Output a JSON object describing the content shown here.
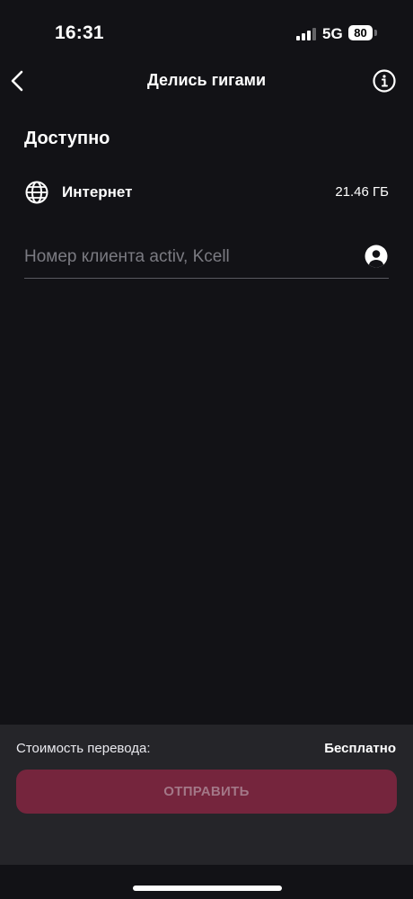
{
  "status_bar": {
    "time": "16:31",
    "network": "5G",
    "battery": "80",
    "icons": [
      "signal-icon",
      "battery-icon"
    ]
  },
  "nav": {
    "title": "Делись гигами",
    "back_icon": "chevron-left-icon",
    "info_icon": "info-icon"
  },
  "available": {
    "title": "Доступно",
    "items": [
      {
        "icon": "globe-icon",
        "label": "Интернет",
        "value": "21.46 ГБ"
      }
    ]
  },
  "recipient": {
    "placeholder": "Номер клиента activ, Kcell",
    "value": "",
    "contact_icon": "contact-icon"
  },
  "footer": {
    "cost_label": "Стоимость перевода:",
    "cost_value": "Бесплатно",
    "send_label": "ОТПРАВИТЬ"
  },
  "colors": {
    "background": "#121216",
    "panel": "#252529",
    "button": "#75253d",
    "button_text": "#a37787"
  }
}
